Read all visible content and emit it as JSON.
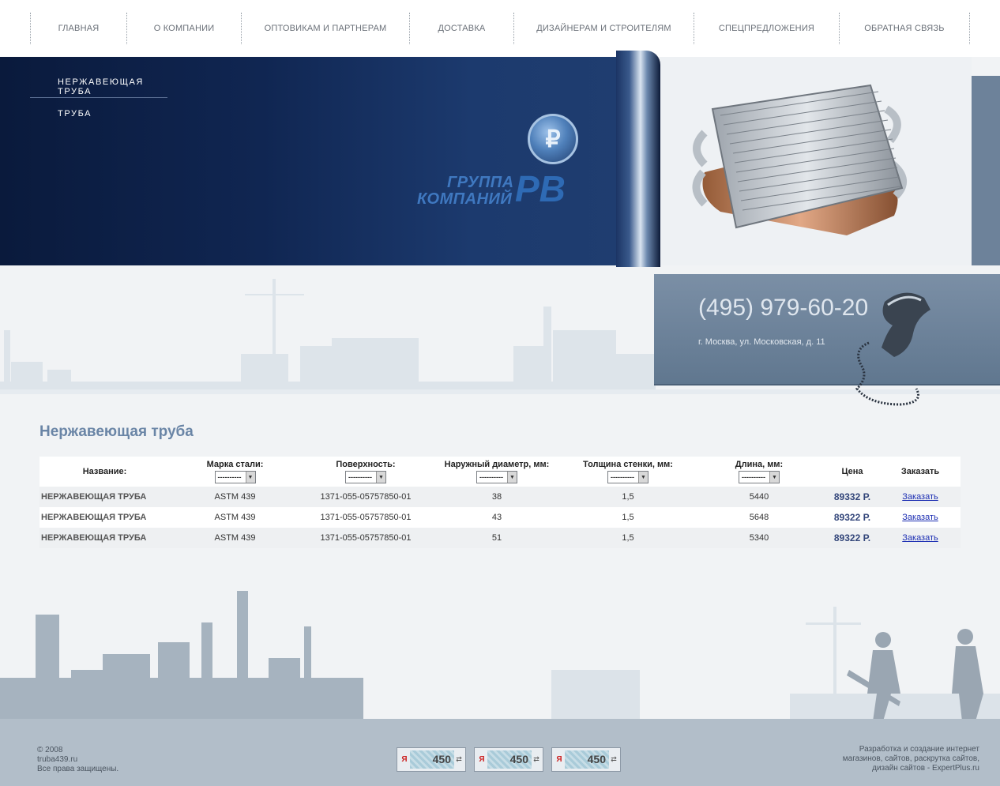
{
  "nav": {
    "items": [
      {
        "label": "ГЛАВНАЯ"
      },
      {
        "label": "О КОМПАНИИ"
      },
      {
        "label": "ОПТОВИКАМ И ПАРТНЕРАМ"
      },
      {
        "label": "ДОСТАВКА"
      },
      {
        "label": "ДИЗАЙНЕРАМ И СТРОИТЕЛЯМ"
      },
      {
        "label": "СПЕЦПРЕДЛОЖЕНИЯ"
      },
      {
        "label": "ОБРАТНАЯ СВЯЗЬ"
      }
    ]
  },
  "side_menu": {
    "items": [
      {
        "label": "НЕРЖАВЕЮЩАЯ ТРУБА"
      },
      {
        "label": "ТРУБА"
      }
    ]
  },
  "logo": {
    "line1": "ГРУППА",
    "line2": "КОМПАНИЙ",
    "mark": "PB"
  },
  "contact": {
    "phone": "(495) 979-60-20",
    "address": "г. Москва, ул. Московская, д. 11"
  },
  "main": {
    "title": "Нержавеющая труба",
    "table": {
      "headers": {
        "name": "Название:",
        "steel": "Марка стали:",
        "surface": "Поверхность:",
        "diameter": "Наружный диаметр, мм:",
        "thickness": "Толщина стенки, мм:",
        "length": "Длина, мм:",
        "price": "Цена",
        "order": "Заказать"
      },
      "filter_value": "----------",
      "rows": [
        {
          "name": "НЕРЖАВЕЮЩАЯ ТРУБА",
          "steel": "ASTM 439",
          "surface": "1371-055-05757850-01",
          "diameter": "38",
          "thickness": "1,5",
          "length": "5440",
          "price": "89332 Р.",
          "order": "Заказать"
        },
        {
          "name": "НЕРЖАВЕЮЩАЯ ТРУБА",
          "steel": "ASTM 439",
          "surface": "1371-055-05757850-01",
          "diameter": "43",
          "thickness": "1,5",
          "length": "5648",
          "price": "89322 Р.",
          "order": "Заказать"
        },
        {
          "name": "НЕРЖАВЕЮЩАЯ ТРУБА",
          "steel": "ASTM 439",
          "surface": "1371-055-05757850-01",
          "diameter": "51",
          "thickness": "1,5",
          "length": "5340",
          "price": "89322 Р.",
          "order": "Заказать"
        }
      ]
    }
  },
  "footer": {
    "copyright": [
      "© 2008",
      "truba439.ru",
      "Все права защищены."
    ],
    "developer": [
      "Разработка и создание интернет",
      "магазинов, сайтов, раскрутка сайтов,",
      "дизайн сайтов - ExpertPlus.ru"
    ],
    "counters": [
      {
        "ya": "Я",
        "value": "450",
        "refresh": "⇄"
      },
      {
        "ya": "Я",
        "value": "450",
        "refresh": "⇄"
      },
      {
        "ya": "Я",
        "value": "450",
        "refresh": "⇄"
      }
    ]
  },
  "colors": {
    "banner_dark": "#102652",
    "accent_blue": "#6a85a6",
    "phone_panel": "#6d829a",
    "price": "#33467a",
    "link": "#1d2fb3",
    "footer": "#b2bec9"
  }
}
